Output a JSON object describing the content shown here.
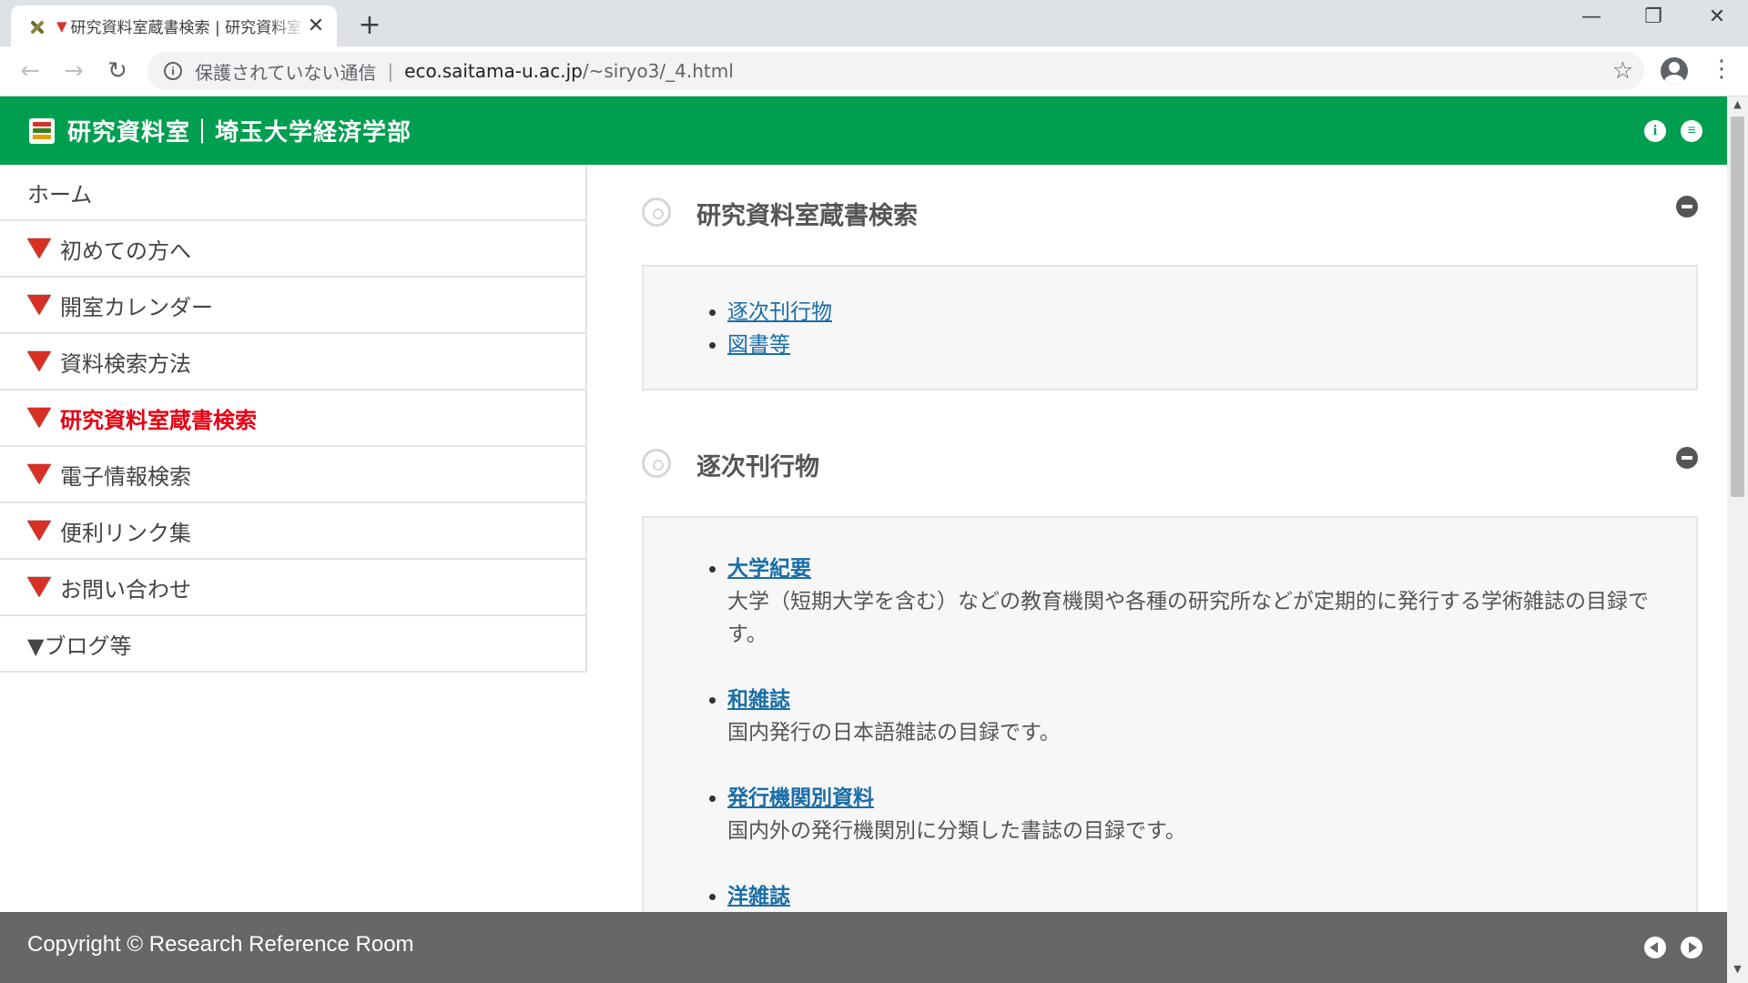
{
  "browser": {
    "tab_title": "研究資料室蔵書検索 | 研究資料室",
    "tab_close": "✕",
    "new_tab": "+",
    "security_label": "保護されていない通信",
    "url_host": "eco.saitama-u.ac.jp",
    "url_path": "/~siryo3/_4.html",
    "icons": {
      "back": "back-arrow-icon",
      "forward": "forward-arrow-icon",
      "reload": "reload-icon",
      "bookmark": "star-icon",
      "profile": "profile-icon",
      "menu": "kebab-menu-icon"
    }
  },
  "header": {
    "site_title": "研究資料室｜埼玉大学経済学部",
    "brand_color": "#009e4f"
  },
  "sidebar": {
    "items": [
      {
        "label": "ホーム",
        "marker": "none"
      },
      {
        "label": "初めての方へ",
        "marker": "red-triangle"
      },
      {
        "label": "開室カレンダー",
        "marker": "red-triangle"
      },
      {
        "label": "資料検索方法",
        "marker": "red-triangle"
      },
      {
        "label": "研究資料室蔵書検索",
        "marker": "red-triangle",
        "active": true
      },
      {
        "label": "電子情報検索",
        "marker": "red-triangle"
      },
      {
        "label": "便利リンク集",
        "marker": "red-triangle"
      },
      {
        "label": "お問い合わせ",
        "marker": "red-triangle"
      },
      {
        "label": "▼ブログ等",
        "marker": "none"
      }
    ],
    "active_color": "#e60012"
  },
  "main": {
    "sections": [
      {
        "title": "研究資料室蔵書検索",
        "links": [
          "逐次刊行物",
          "図書等"
        ]
      },
      {
        "title": "逐次刊行物",
        "entries": [
          {
            "title": "大学紀要",
            "desc": "大学（短期大学を含む）などの教育機関や各種の研究所などが定期的に発行する学術雑誌の目録です。"
          },
          {
            "title": "和雑誌",
            "desc": "国内発行の日本語雑誌の目録です。"
          },
          {
            "title": "発行機関別資料",
            "desc": "国内外の発行機関別に分類した書誌の目録です。"
          },
          {
            "title": "洋雑誌",
            "desc": ""
          }
        ]
      }
    ]
  },
  "footer": {
    "copyright": "Copyright © Research Reference Room"
  }
}
